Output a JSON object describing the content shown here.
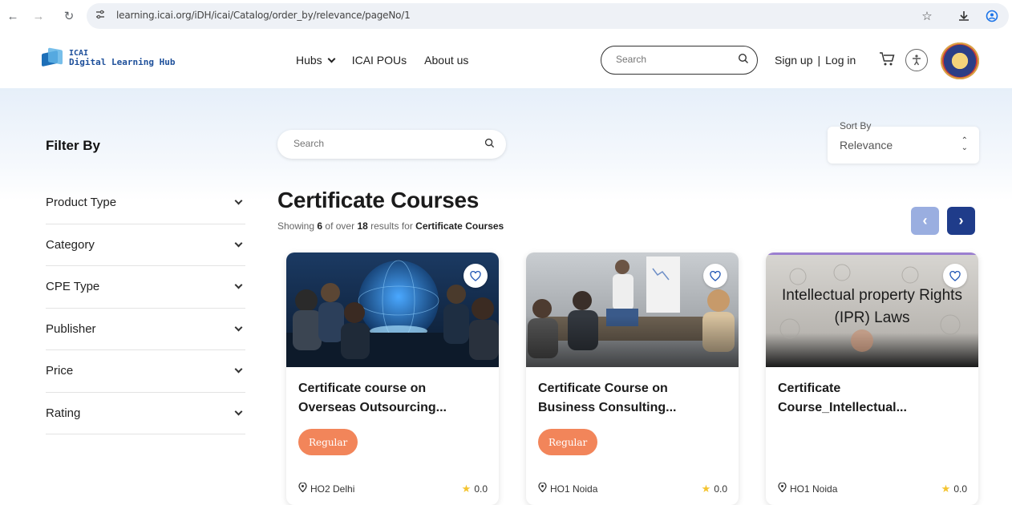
{
  "browser": {
    "url": "learning.icai.org/iDH/icai/Catalog/order_by/relevance/pageNo/1",
    "back_icon": "arrow-left-icon",
    "forward_icon": "arrow-right-icon",
    "reload_icon": "reload-icon"
  },
  "header": {
    "logo_line1": "ICAI",
    "logo_line2": "Digital Learning Hub",
    "nav": [
      "Hubs",
      "ICAI POUs",
      "About us"
    ],
    "search_placeholder": "Search",
    "signup": "Sign up",
    "separator": "|",
    "login": "Log in"
  },
  "filters": {
    "title": "Filter By",
    "items": [
      "Product Type",
      "Category",
      "CPE Type",
      "Publisher",
      "Price",
      "Rating"
    ]
  },
  "search": {
    "placeholder": "Search"
  },
  "sort": {
    "label": "Sort By",
    "value": "Relevance"
  },
  "listing": {
    "heading": "Certificate Courses",
    "showing_prefix": "Showing",
    "shown_count": "6",
    "of_over": "of over",
    "total_count": "18",
    "results_for": "results for",
    "category": "Certificate Courses"
  },
  "cards": [
    {
      "title": "Certificate course on Overseas Outsourcing...",
      "badge": "Regular",
      "location": "HO2 Delhi",
      "rating": "0.0",
      "image_caption": ""
    },
    {
      "title": "Certificate Course on Business Consulting...",
      "badge": "Regular",
      "location": "HO1 Noida",
      "rating": "0.0",
      "image_caption": ""
    },
    {
      "title": "Certificate Course_Intellectual...",
      "badge": "",
      "location": "HO1 Noida",
      "rating": "0.0",
      "image_caption": "Intellectual property Rights (IPR) Laws"
    }
  ],
  "colors": {
    "accent": "#1f3c8a",
    "badge": "#f2855a",
    "star": "#f4c430"
  }
}
